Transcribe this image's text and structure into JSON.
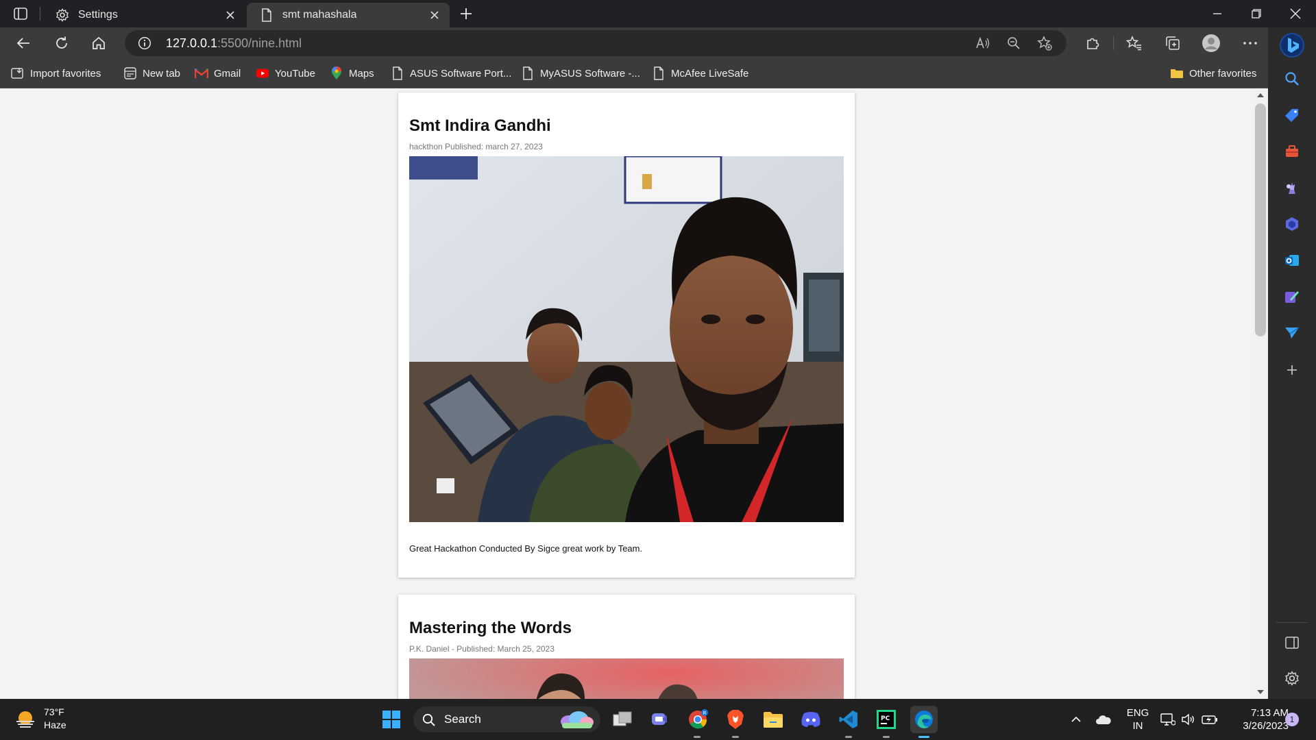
{
  "browser": {
    "tabs": [
      {
        "label": "Settings",
        "icon": "gear-icon",
        "active": false
      },
      {
        "label": "smt mahashala",
        "icon": "page-icon",
        "active": true
      }
    ],
    "address": {
      "host": "127.0.0.1",
      "path": ":5500/nine.html"
    },
    "favorites": [
      {
        "label": "Import favorites",
        "icon": "import-icon"
      },
      {
        "label": "New tab",
        "icon": "newtab-icon"
      },
      {
        "label": "Gmail",
        "icon": "gmail-icon"
      },
      {
        "label": "YouTube",
        "icon": "youtube-icon"
      },
      {
        "label": "Maps",
        "icon": "maps-icon"
      },
      {
        "label": "ASUS Software Port...",
        "icon": "page-icon"
      },
      {
        "label": "MyASUS Software -...",
        "icon": "page-icon"
      },
      {
        "label": "McAfee LiveSafe",
        "icon": "page-icon"
      },
      {
        "label": "Other favorites",
        "icon": "folder-icon"
      }
    ]
  },
  "posts": [
    {
      "title": "Smt Indira Gandhi",
      "meta": "hackthon Published: march 27, 2023",
      "body": "Great Hackathon Conducted By Sigce great work by Team."
    },
    {
      "title": "Mastering the Words",
      "meta": "P.K. Daniel - Published: March 25, 2023"
    }
  ],
  "taskbar": {
    "weather": {
      "temp": "73°F",
      "condition": "Haze"
    },
    "search_label": "Search",
    "lang": {
      "line1": "ENG",
      "line2": "IN"
    },
    "clock": {
      "time": "7:13 AM",
      "date": "3/26/2023"
    },
    "notification_count": "1"
  },
  "colors": {
    "accent": "#0f6cbd",
    "tab_bar": "#202124",
    "toolbar": "#3b3b3b",
    "taskbar": "#202020"
  }
}
